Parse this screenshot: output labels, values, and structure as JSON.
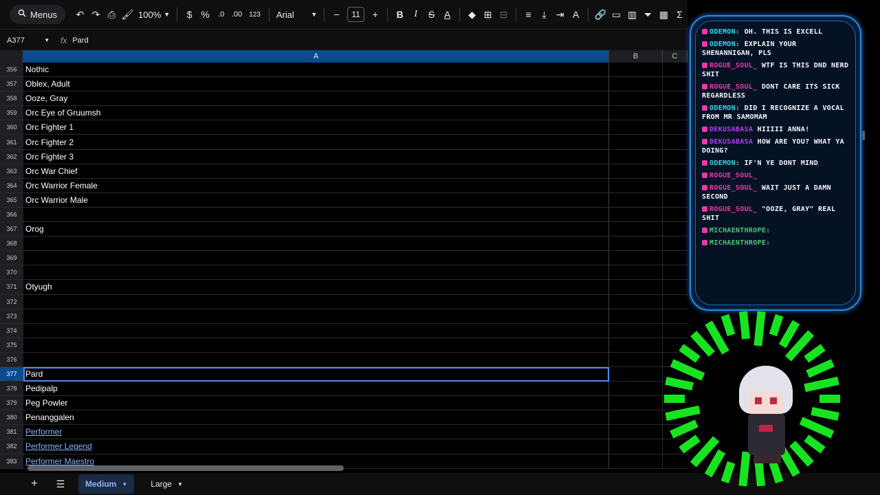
{
  "toolbar": {
    "menus": "Menus",
    "zoom": "100%",
    "currency": "$",
    "percent": "%",
    "dec_less": ".0",
    "dec_more": ".00",
    "number_format": "123",
    "font": "Arial",
    "font_size": "11",
    "bold": "B",
    "italic": "I",
    "strike": "S",
    "text_color": "A"
  },
  "formula_bar": {
    "cell_ref": "A377",
    "fx": "fx",
    "value": "Pard"
  },
  "columns": [
    "A",
    "B",
    "C"
  ],
  "rows": [
    {
      "num": "356",
      "a": "Nothic"
    },
    {
      "num": "357",
      "a": "Oblex, Adult"
    },
    {
      "num": "358",
      "a": "Ooze, Gray"
    },
    {
      "num": "359",
      "a": "Orc Eye of Gruumsh"
    },
    {
      "num": "360",
      "a": "Orc Fighter 1"
    },
    {
      "num": "361",
      "a": "Orc Fighter 2"
    },
    {
      "num": "362",
      "a": "Orc Fighter 3"
    },
    {
      "num": "363",
      "a": "Orc War Chief"
    },
    {
      "num": "364",
      "a": "Orc Warrior Female"
    },
    {
      "num": "365",
      "a": "Orc Warrior Male"
    },
    {
      "num": "366",
      "a": ""
    },
    {
      "num": "367",
      "a": "Orog"
    },
    {
      "num": "368",
      "a": ""
    },
    {
      "num": "369",
      "a": ""
    },
    {
      "num": "370",
      "a": ""
    },
    {
      "num": "371",
      "a": "Otyugh"
    },
    {
      "num": "372",
      "a": ""
    },
    {
      "num": "373",
      "a": ""
    },
    {
      "num": "374",
      "a": ""
    },
    {
      "num": "375",
      "a": ""
    },
    {
      "num": "376",
      "a": ""
    },
    {
      "num": "377",
      "a": "Pard"
    },
    {
      "num": "378",
      "a": "Pedipalp"
    },
    {
      "num": "379",
      "a": "Peg Powler"
    },
    {
      "num": "380",
      "a": "Penanggalen"
    },
    {
      "num": "381",
      "a": "Performer"
    },
    {
      "num": "382",
      "a": "Performer Legend"
    },
    {
      "num": "383",
      "a": "Performer Maestro"
    }
  ],
  "sheet_tabs": [
    "Medium",
    "Large"
  ],
  "chat": [
    {
      "name": "ODEMON:",
      "text": "OH. THIS IS EXCELL",
      "color": "#33d9e8"
    },
    {
      "name": "ODEMON:",
      "text": "EXPLAIN YOUR SHENANNIGAN, PLS",
      "color": "#33d9e8"
    },
    {
      "name": "ROGUE_SOUL_",
      "text": "WTF IS THIS DND NERD SHIT",
      "color": "#e93aa8"
    },
    {
      "name": "ROGUE_SOUL_",
      "text": "DONT CARE ITS SICK REGARDLESS",
      "color": "#e93aa8"
    },
    {
      "name": "ODEMON:",
      "text": "DID I RECOGNIZE A VOCAL FROM MR SAMOMAM",
      "color": "#33d9e8"
    },
    {
      "name": "DEKUSABASA",
      "text": "HIIIII ANNA!",
      "color": "#b23cf0"
    },
    {
      "name": "DEKUSABASA",
      "text": "HOW ARE YOU? WHAT YA DOING?",
      "color": "#b23cf0"
    },
    {
      "name": "ODEMON:",
      "text": "IF'N YE DONT MIND",
      "color": "#33d9e8"
    },
    {
      "name": "ROGUE_SOUL_",
      "text": "",
      "color": "#e93aa8"
    },
    {
      "name": "ROGUE_SOUL_",
      "text": "WAIT JUST A DAMN SECOND",
      "color": "#e93aa8"
    },
    {
      "name": "ROGUE_SOUL_",
      "text": "\"OOZE, GRAY\" REAL SHIT",
      "color": "#e93aa8"
    },
    {
      "name": "MICHAENTHROPE:",
      "text": "",
      "color": "#4fc27b"
    },
    {
      "name": "MICHAENTHROPE:",
      "text": "",
      "color": "#4fc27b"
    }
  ]
}
